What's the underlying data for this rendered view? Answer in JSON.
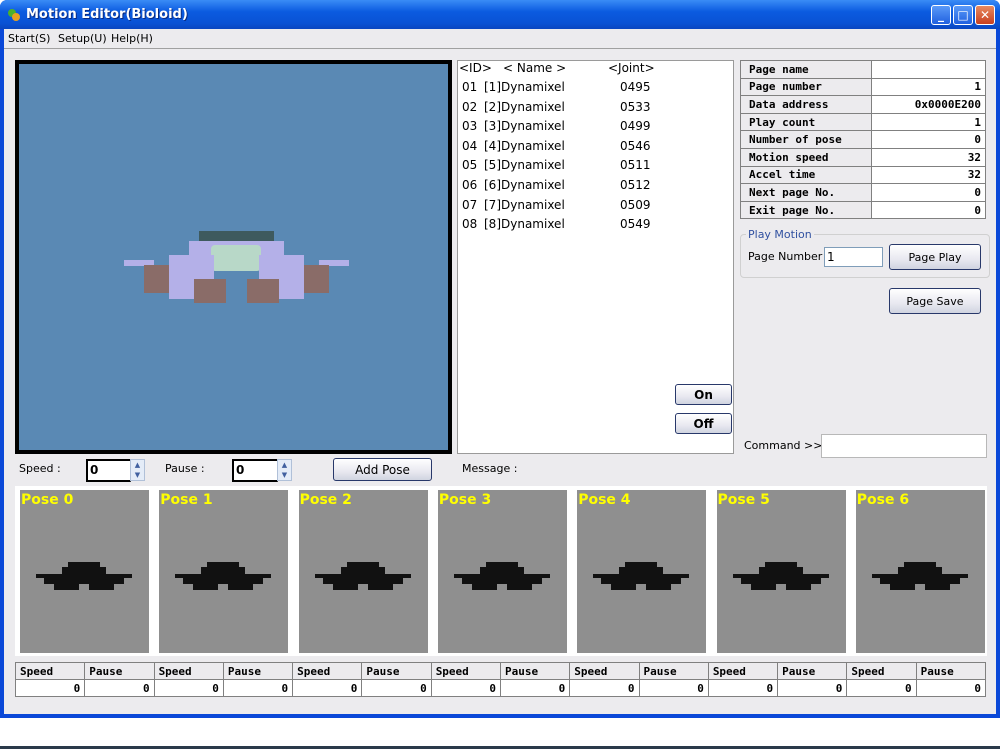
{
  "window": {
    "title": "Motion Editor(Bioloid)",
    "buttons": [
      "minimize",
      "maximize",
      "close"
    ]
  },
  "menu": [
    "Start(S)",
    "Setup(U)",
    "Help(H)"
  ],
  "joint_list": {
    "headers": [
      "<ID>",
      "< Name >",
      "<Joint>"
    ],
    "rows": [
      {
        "id": "01",
        "name": "[1]Dynamixel",
        "joint": "0495"
      },
      {
        "id": "02",
        "name": "[2]Dynamixel",
        "joint": "0533"
      },
      {
        "id": "03",
        "name": "[3]Dynamixel",
        "joint": "0499"
      },
      {
        "id": "04",
        "name": "[4]Dynamixel",
        "joint": "0546"
      },
      {
        "id": "05",
        "name": "[5]Dynamixel",
        "joint": "0511"
      },
      {
        "id": "06",
        "name": "[6]Dynamixel",
        "joint": "0512"
      },
      {
        "id": "07",
        "name": "[7]Dynamixel",
        "joint": "0509"
      },
      {
        "id": "08",
        "name": "[8]Dynamixel",
        "joint": "0549"
      }
    ]
  },
  "page_info": [
    {
      "label": "Page name",
      "value": ""
    },
    {
      "label": "Page number",
      "value": "1"
    },
    {
      "label": "Data address",
      "value": "0x0000E200"
    },
    {
      "label": "Play count",
      "value": "1"
    },
    {
      "label": "Number of pose",
      "value": "0"
    },
    {
      "label": "Motion speed",
      "value": "32"
    },
    {
      "label": "Accel time",
      "value": "32"
    },
    {
      "label": "Next page No.",
      "value": "0"
    },
    {
      "label": "Exit page No.",
      "value": "0"
    }
  ],
  "play_motion": {
    "group_label": "Play Motion",
    "page_number_label": "Page Number :",
    "page_number_value": "1",
    "page_play": "Page Play"
  },
  "page_save": "Page Save",
  "on": "On",
  "off": "Off",
  "command": {
    "label": "Command >>",
    "value": ""
  },
  "pose_controls": {
    "speed_label": "Speed :",
    "speed_value": "0",
    "pause_label": "Pause :",
    "pause_value": "0",
    "add_pose": "Add Pose",
    "message_label": "Message :"
  },
  "poses": [
    "Pose 0",
    "Pose 1",
    "Pose 2",
    "Pose 3",
    "Pose 4",
    "Pose 5",
    "Pose 6"
  ],
  "pose_table": {
    "headers": [
      "Speed",
      "Pause"
    ],
    "values": [
      [
        "0",
        "0"
      ],
      [
        "0",
        "0"
      ],
      [
        "0",
        "0"
      ],
      [
        "0",
        "0"
      ],
      [
        "0",
        "0"
      ],
      [
        "0",
        "0"
      ],
      [
        "0",
        "0"
      ]
    ]
  },
  "colors": {
    "viewport_bg": "#5a89b4",
    "pose_bg": "#8f8f8f",
    "pose_label": "#ffff00"
  }
}
